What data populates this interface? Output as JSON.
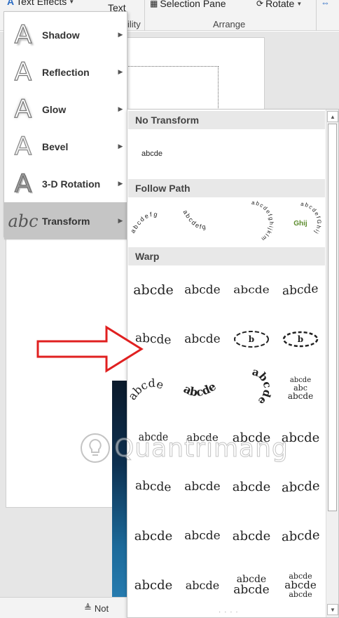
{
  "ribbon": {
    "text_effects_label": "Text Effects",
    "text_label": "Text",
    "text_group_partial": "ility",
    "selection_pane_label": "Selection Pane",
    "rotate_label": "Rotate",
    "arrange_group_label": "Arrange"
  },
  "effects_menu": {
    "items": [
      {
        "label": "Shadow",
        "icon": "shadow-a-icon"
      },
      {
        "label": "Reflection",
        "icon": "reflection-a-icon"
      },
      {
        "label": "Glow",
        "icon": "glow-a-icon"
      },
      {
        "label": "Bevel",
        "icon": "bevel-a-icon"
      },
      {
        "label": "3-D Rotation",
        "icon": "3d-rotation-a-icon"
      },
      {
        "label": "Transform",
        "icon": "transform-abc-icon",
        "active": true
      }
    ]
  },
  "gallery": {
    "sections": {
      "no_transform": "No Transform",
      "follow_path": "Follow Path",
      "warp": "Warp"
    },
    "sample_text": "abcde",
    "follow_path_samples": [
      "abcdefg",
      "abcdefg",
      "abcdefghijklm",
      "abcdefGhij"
    ],
    "warp_extra": {
      "abc": "abc"
    }
  },
  "status": {
    "notes_label": "Not"
  },
  "watermark": {
    "brand": "Quantrimang"
  },
  "colors": {
    "arrow": "#e02020",
    "active_item": "#c5c5c5"
  }
}
